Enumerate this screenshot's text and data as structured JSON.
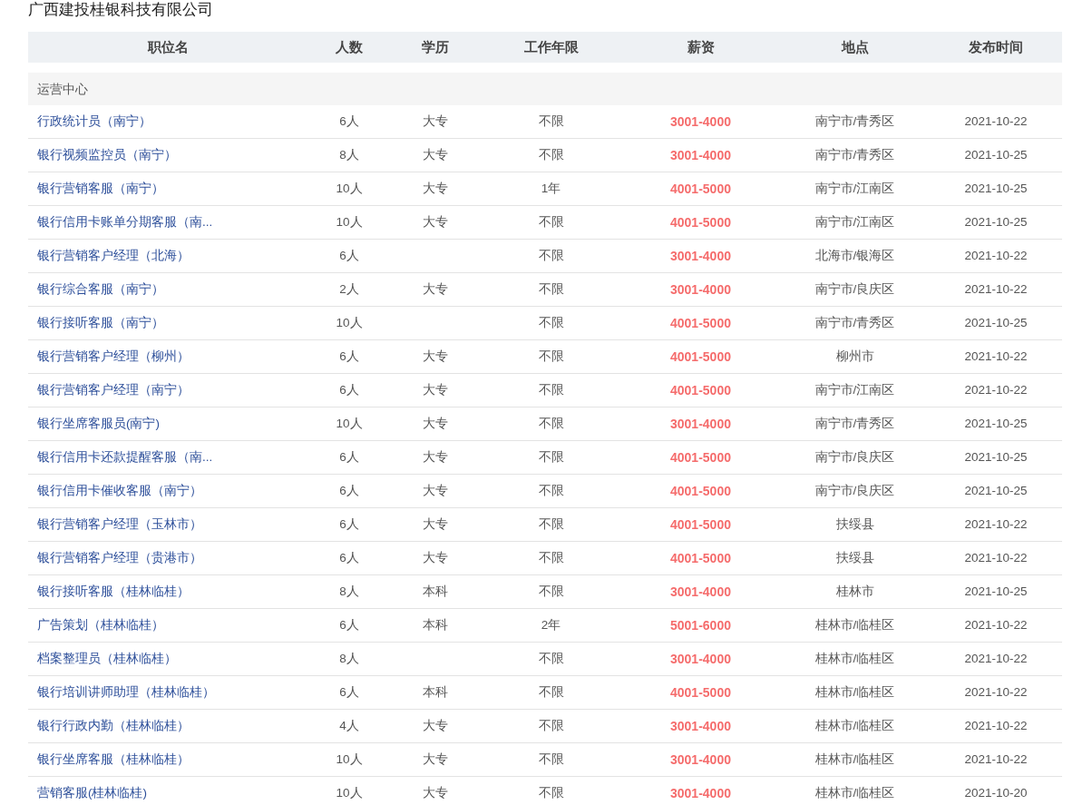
{
  "company": "广西建投桂银科技有限公司",
  "table": {
    "columns": [
      "职位名",
      "人数",
      "学历",
      "工作年限",
      "薪资",
      "地点",
      "发布时间"
    ],
    "sections": [
      {
        "name": "运营中心",
        "rows": [
          {
            "title": "行政统计员（南宁）",
            "headcount": "6人",
            "education": "大专",
            "experience": "不限",
            "salary": "3001-4000",
            "location": "南宁市/青秀区",
            "date": "2021-10-22"
          },
          {
            "title": "银行视频监控员（南宁）",
            "headcount": "8人",
            "education": "大专",
            "experience": "不限",
            "salary": "3001-4000",
            "location": "南宁市/青秀区",
            "date": "2021-10-25"
          },
          {
            "title": "银行营销客服（南宁）",
            "headcount": "10人",
            "education": "大专",
            "experience": "1年",
            "salary": "4001-5000",
            "location": "南宁市/江南区",
            "date": "2021-10-25"
          },
          {
            "title": "银行信用卡账单分期客服（南...",
            "headcount": "10人",
            "education": "大专",
            "experience": "不限",
            "salary": "4001-5000",
            "location": "南宁市/江南区",
            "date": "2021-10-25"
          },
          {
            "title": "银行营销客户经理（北海）",
            "headcount": "6人",
            "experience": "不限",
            "salary": "3001-4000",
            "location": "北海市/银海区",
            "date": "2021-10-22"
          },
          {
            "title": "银行综合客服（南宁）",
            "headcount": "2人",
            "education": "大专",
            "experience": "不限",
            "salary": "3001-4000",
            "location": "南宁市/良庆区",
            "date": "2021-10-22"
          },
          {
            "title": "银行接听客服（南宁）",
            "headcount": "10人",
            "experience": "不限",
            "salary": "4001-5000",
            "location": "南宁市/青秀区",
            "date": "2021-10-25"
          },
          {
            "title": "银行营销客户经理（柳州）",
            "headcount": "6人",
            "education": "大专",
            "experience": "不限",
            "salary": "4001-5000",
            "location": "柳州市",
            "date": "2021-10-22"
          },
          {
            "title": "银行营销客户经理（南宁）",
            "headcount": "6人",
            "education": "大专",
            "experience": "不限",
            "salary": "4001-5000",
            "location": "南宁市/江南区",
            "date": "2021-10-22"
          },
          {
            "title": "银行坐席客服员(南宁)",
            "headcount": "10人",
            "education": "大专",
            "experience": "不限",
            "salary": "3001-4000",
            "location": "南宁市/青秀区",
            "date": "2021-10-25"
          },
          {
            "title": "银行信用卡还款提醒客服（南...",
            "headcount": "6人",
            "education": "大专",
            "experience": "不限",
            "salary": "4001-5000",
            "location": "南宁市/良庆区",
            "date": "2021-10-25"
          },
          {
            "title": "银行信用卡催收客服（南宁）",
            "headcount": "6人",
            "education": "大专",
            "experience": "不限",
            "salary": "4001-5000",
            "location": "南宁市/良庆区",
            "date": "2021-10-25"
          },
          {
            "title": "银行营销客户经理（玉林市）",
            "headcount": "6人",
            "education": "大专",
            "experience": "不限",
            "salary": "4001-5000",
            "location": "扶绥县",
            "date": "2021-10-22"
          },
          {
            "title": "银行营销客户经理（贵港市）",
            "headcount": "6人",
            "education": "大专",
            "experience": "不限",
            "salary": "4001-5000",
            "location": "扶绥县",
            "date": "2021-10-22"
          },
          {
            "title": "银行接听客服（桂林临桂）",
            "headcount": "8人",
            "education": "本科",
            "experience": "不限",
            "salary": "3001-4000",
            "location": "桂林市",
            "date": "2021-10-25"
          },
          {
            "title": "广告策划（桂林临桂）",
            "headcount": "6人",
            "education": "本科",
            "experience": "2年",
            "salary": "5001-6000",
            "location": "桂林市/临桂区",
            "date": "2021-10-22"
          },
          {
            "title": "档案整理员（桂林临桂）",
            "headcount": "8人",
            "experience": "不限",
            "salary": "3001-4000",
            "location": "桂林市/临桂区",
            "date": "2021-10-22"
          },
          {
            "title": "银行培训讲师助理（桂林临桂）",
            "headcount": "6人",
            "education": "本科",
            "experience": "不限",
            "salary": "4001-5000",
            "location": "桂林市/临桂区",
            "date": "2021-10-22"
          },
          {
            "title": "银行行政内勤（桂林临桂）",
            "headcount": "4人",
            "education": "大专",
            "experience": "不限",
            "salary": "3001-4000",
            "location": "桂林市/临桂区",
            "date": "2021-10-22"
          },
          {
            "title": "银行坐席客服（桂林临桂）",
            "headcount": "10人",
            "education": "大专",
            "experience": "不限",
            "salary": "3001-4000",
            "location": "桂林市/临桂区",
            "date": "2021-10-22"
          },
          {
            "title": "营销客服(桂林临桂)",
            "headcount": "10人",
            "education": "大专",
            "experience": "不限",
            "salary": "3001-4000",
            "location": "桂林市/临桂区",
            "date": "2021-10-20"
          }
        ]
      }
    ]
  }
}
